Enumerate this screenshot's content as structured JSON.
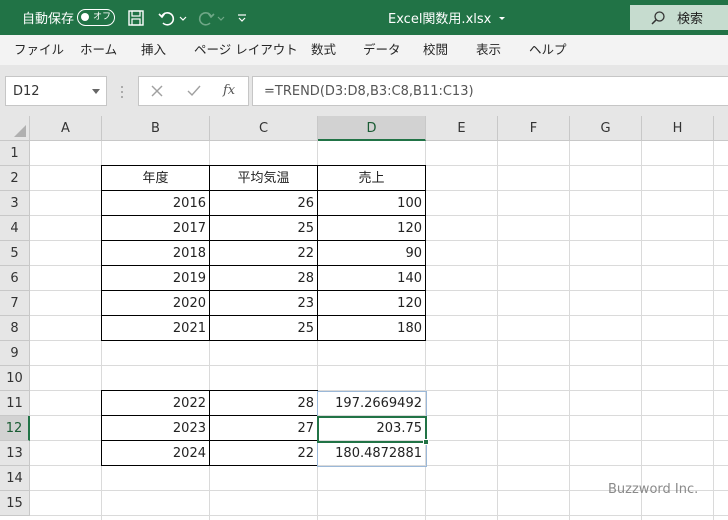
{
  "titlebar": {
    "autosave_label": "自動保存",
    "autosave_state": "オフ",
    "filename": "Excel関数用.xlsx",
    "search_label": "検索",
    "bg_color": "#217346"
  },
  "ribbon": {
    "tabs": [
      "ファイル",
      "ホーム",
      "挿入",
      "ページ レイアウト",
      "数式",
      "データ",
      "校閲",
      "表示",
      "ヘルプ"
    ]
  },
  "formula_bar": {
    "name_box": "D12",
    "fx": "fx",
    "formula": "=TREND(D3:D8,B3:C8,B11:C13)"
  },
  "sheet": {
    "columns": [
      "A",
      "B",
      "C",
      "D",
      "E",
      "F",
      "G",
      "H"
    ],
    "rows": [
      "1",
      "2",
      "3",
      "4",
      "5",
      "6",
      "7",
      "8",
      "9",
      "10",
      "11",
      "12",
      "13",
      "14",
      "15"
    ],
    "selected_column": "D",
    "selected_row": "12",
    "headers": [
      "年度",
      "平均気温",
      "売上"
    ],
    "data": [
      [
        "2016",
        "26",
        "100"
      ],
      [
        "2017",
        "25",
        "120"
      ],
      [
        "2018",
        "22",
        "90"
      ],
      [
        "2019",
        "28",
        "140"
      ],
      [
        "2020",
        "23",
        "120"
      ],
      [
        "2021",
        "25",
        "180"
      ]
    ],
    "forecast": [
      [
        "2022",
        "28",
        "197.2669492"
      ],
      [
        "2023",
        "27",
        "203.75"
      ],
      [
        "2024",
        "22",
        "180.4872881"
      ]
    ]
  },
  "watermark": "Buzzword Inc."
}
